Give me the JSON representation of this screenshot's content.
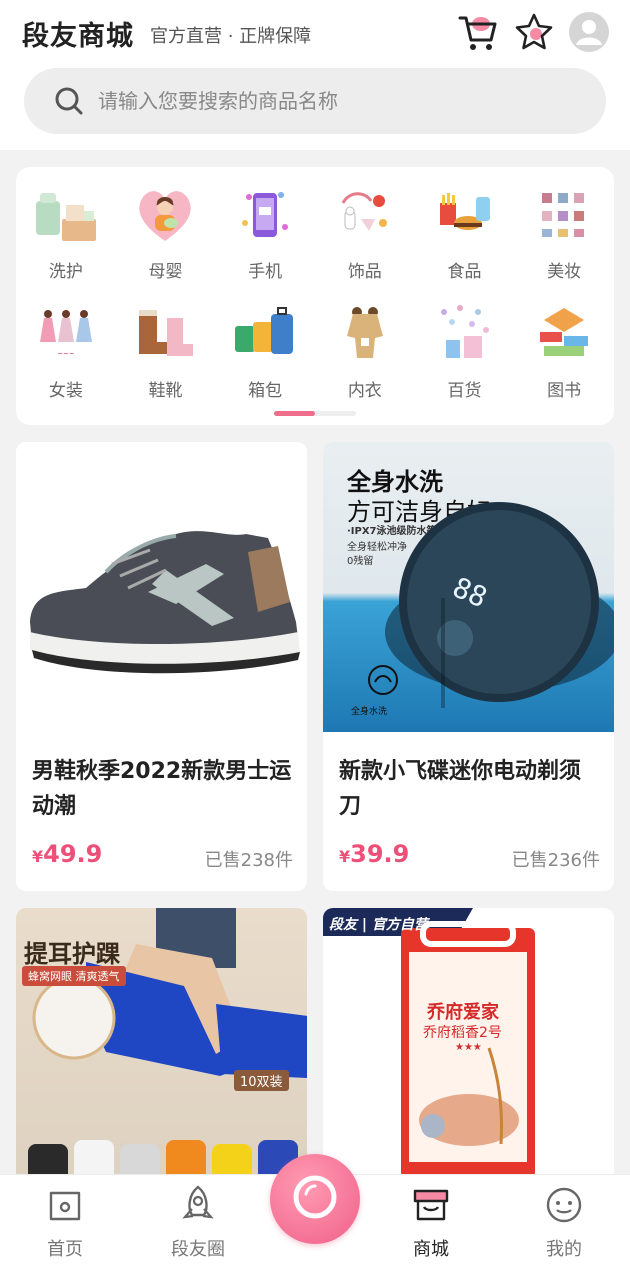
{
  "header": {
    "brand": "段友商城",
    "tagline": "官方直营 · 正牌保障",
    "cart_icon": "cart-icon",
    "favorites_icon": "star-icon",
    "profile_icon": "avatar-icon"
  },
  "search": {
    "placeholder": "请输入您要搜索的商品名称",
    "icon": "search-icon"
  },
  "categories": [
    {
      "label": "洗护",
      "icon": "wash-care-icon"
    },
    {
      "label": "母婴",
      "icon": "mother-baby-icon"
    },
    {
      "label": "手机",
      "icon": "phone-icon"
    },
    {
      "label": "饰品",
      "icon": "accessories-icon"
    },
    {
      "label": "食品",
      "icon": "food-icon"
    },
    {
      "label": "美妆",
      "icon": "makeup-icon"
    },
    {
      "label": "女装",
      "icon": "womens-clothing-icon"
    },
    {
      "label": "鞋靴",
      "icon": "shoes-boots-icon"
    },
    {
      "label": "箱包",
      "icon": "luggage-icon"
    },
    {
      "label": "内衣",
      "icon": "underwear-icon"
    },
    {
      "label": "百货",
      "icon": "general-goods-icon"
    },
    {
      "label": "图书",
      "icon": "books-icon"
    }
  ],
  "category_pager": {
    "pages": 2,
    "current": 1
  },
  "products": [
    {
      "name": "男鞋秋季2022新款男士运动潮",
      "currency": "¥",
      "price": "49.9",
      "sold": "已售238件"
    },
    {
      "name": "新款小飞碟迷你电动剃须刀",
      "currency": "¥",
      "price": "39.9",
      "sold": "已售236件",
      "image_text": {
        "headline": "全身水洗",
        "subhead": "方可洁身自好",
        "line1": "·IPX7泳池级防水等级",
        "line2": "全身轻松冲净",
        "line3": "0残留",
        "badge": "全身水洗",
        "display": "88"
      }
    },
    {
      "image_text": {
        "headline": "提耳护踝",
        "subhead": "蜂窝网眼 清爽透气",
        "tag": "10双装"
      }
    },
    {
      "image_text": {
        "banner": "段友 | 官方自营",
        "brand": "乔府爱家",
        "product": "乔府稻香2号",
        "stars": "★★★"
      }
    }
  ],
  "tabbar": [
    {
      "label": "首页",
      "icon": "home-icon"
    },
    {
      "label": "段友圈",
      "icon": "rocket-icon"
    },
    {
      "label": "商城",
      "icon": "shop-icon",
      "active": true
    },
    {
      "label": "我的",
      "icon": "smiley-icon"
    }
  ],
  "camera_button": {
    "icon": "camera-icon"
  },
  "colors": {
    "accent": "#ee4f78",
    "pink": "#f06088",
    "background": "#f2f2f2"
  }
}
